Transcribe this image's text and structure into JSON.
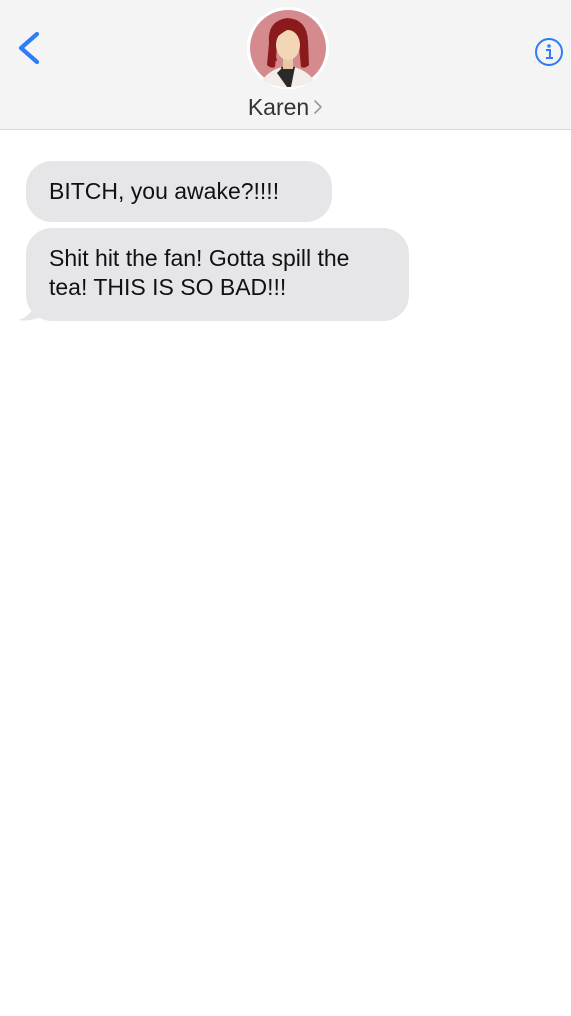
{
  "header": {
    "contact_name": "Karen",
    "back_icon": "chevron-left-icon",
    "info_icon": "info-circle-icon",
    "chevron_icon": "chevron-right-icon",
    "accent_color": "#2f7cf6"
  },
  "messages": [
    {
      "direction": "incoming",
      "text": "BITCH, you awake?!!!!"
    },
    {
      "direction": "incoming",
      "text": "Shit hit the fan! Gotta spill the tea! THIS IS SO BAD!!!"
    }
  ]
}
